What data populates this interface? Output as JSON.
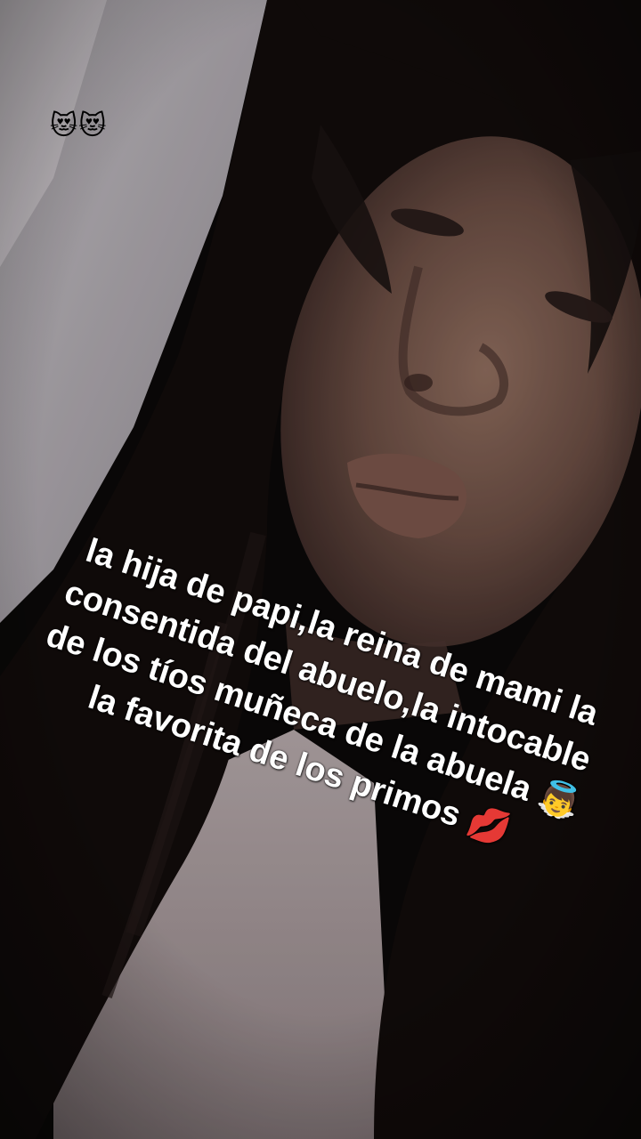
{
  "overlay": {
    "top_emojis": "😻😻",
    "caption_lines": [
      "la hija de papi,la reina de mami la",
      "consentida del abuelo,la intocable",
      "de los tíos muñeca de la abuela 👼",
      "la favorita de los primos 💋"
    ],
    "caption_color": "#ffffff"
  },
  "photo": {
    "palette": {
      "background": "#0b0908",
      "hair": "#120c0b",
      "skin_shadow": "#5c4238",
      "skin_light": "#8f6d5e",
      "wall": "#cfc9cf",
      "shirt": "#c6b7ba"
    }
  }
}
